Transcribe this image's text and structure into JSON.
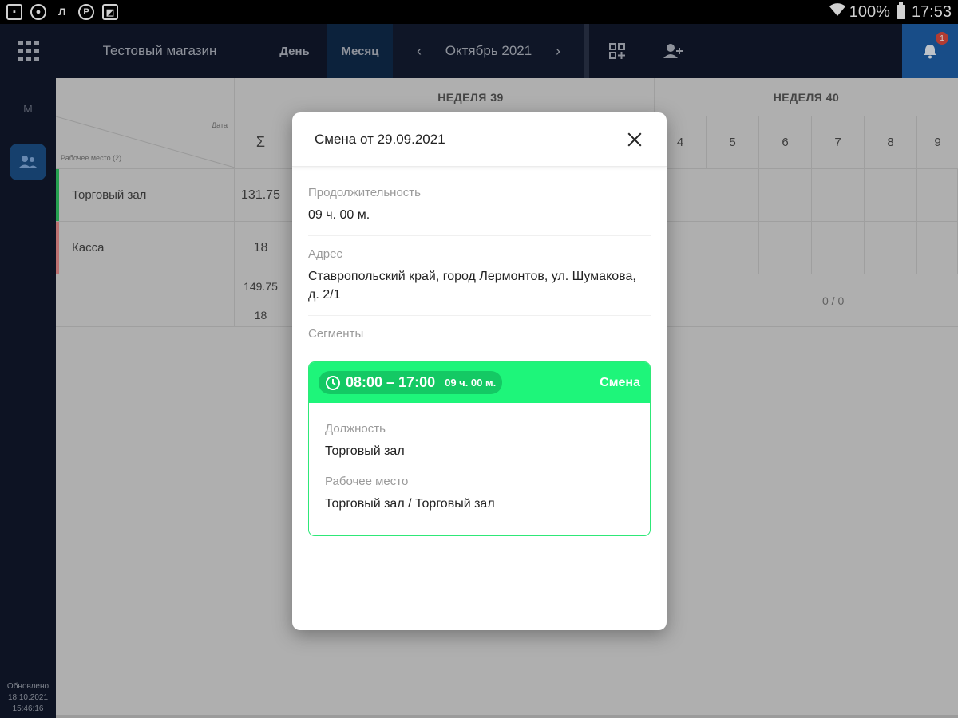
{
  "status_bar": {
    "battery": "100%",
    "time": "17:53"
  },
  "appbar": {
    "store_name": "Тестовый магазин",
    "tab_day": "День",
    "tab_month": "Месяц",
    "prev_arrow": "‹",
    "period": "Октябрь 2021",
    "next_arrow": "›",
    "notification_count": "1"
  },
  "rail": {
    "letter": "М",
    "updated_label": "Обновлено",
    "updated_date": "18.10.2021",
    "updated_time": "15:46:16"
  },
  "table": {
    "week_39": "НЕДЕЛЯ 39",
    "week_40": "НЕДЕЛЯ 40",
    "corner_date": "Дата",
    "corner_workplace": "Рабочее место (2)",
    "sum_symbol": "Σ",
    "days": [
      "4",
      "5",
      "6",
      "7",
      "8",
      "9"
    ],
    "rows": [
      {
        "name": "Торговый зал",
        "sum": "131.75"
      },
      {
        "name": "Касса",
        "sum": "18"
      }
    ],
    "total_top": "149.75",
    "total_dash": "–",
    "total_bottom": "18",
    "total_right": "0 / 0"
  },
  "modal": {
    "title": "Смена от 29.09.2021",
    "duration_label": "Продолжительность",
    "duration_value": "09 ч. 00 м.",
    "address_label": "Адрес",
    "address_value": "Ставропольский край, город Лермонтов, ул. Шумакова, д. 2/1",
    "segments_label": "Сегменты",
    "segment": {
      "time": "08:00 – 17:00",
      "duration": "09 ч. 00 м.",
      "type": "Смена",
      "position_label": "Должность",
      "position_value": "Торговый зал",
      "workplace_label": "Рабочее место",
      "workplace_value": "Торговый зал / Торговый зал"
    }
  },
  "colors": {
    "appbar": "#10182b",
    "accent_blue": "#1e5fa6",
    "segment_green": "#1ef57a",
    "row_green": "#2ec462",
    "row_red": "#e68a8a"
  }
}
